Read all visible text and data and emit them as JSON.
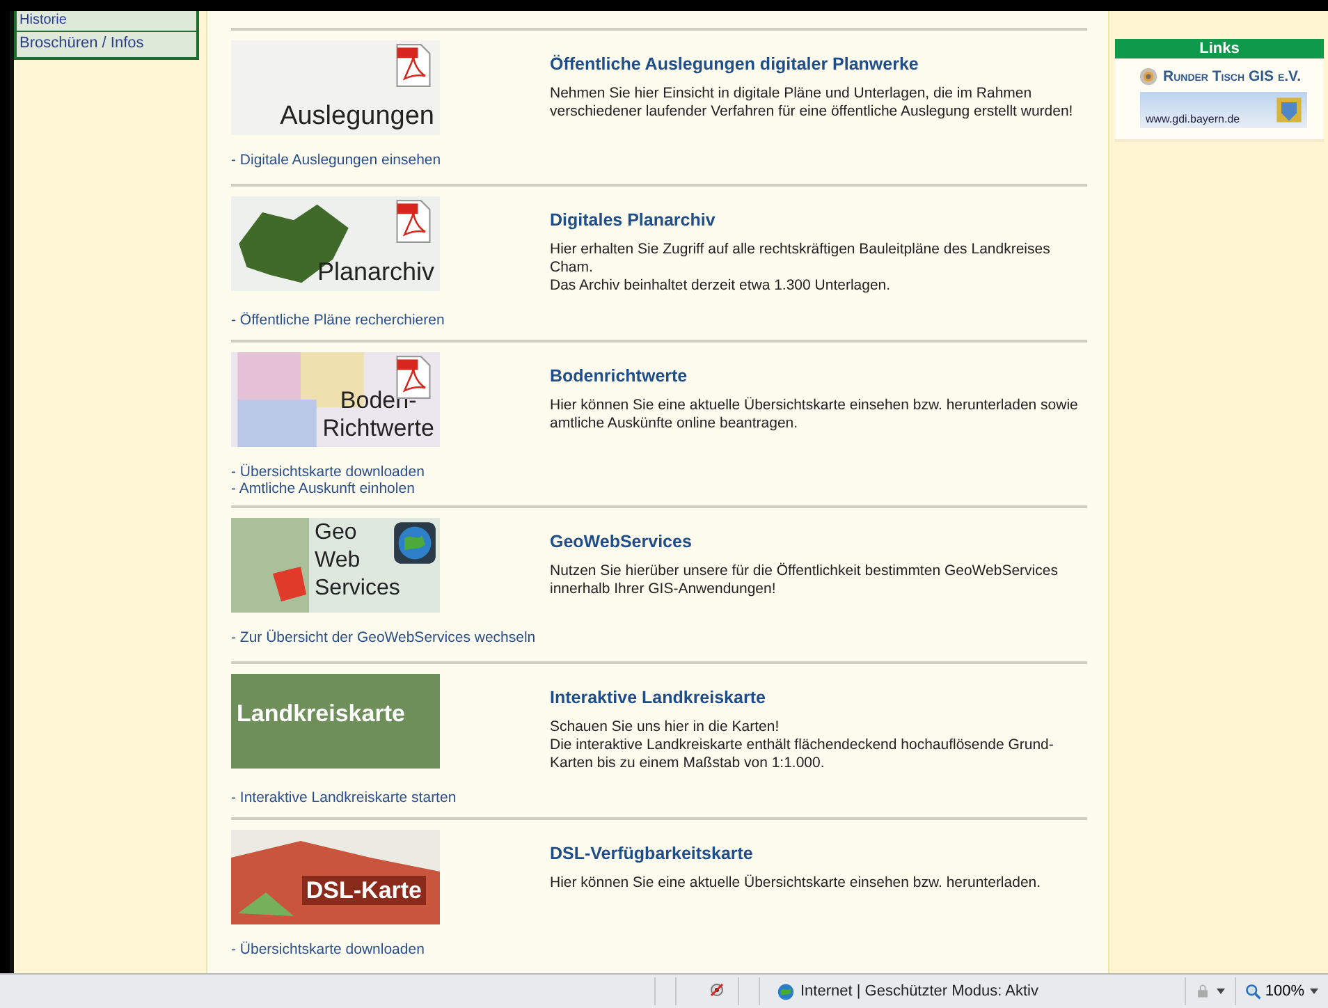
{
  "sidebar": {
    "items": [
      {
        "label": "Historie",
        "selected": false
      },
      {
        "label": "Broschüren / Infos",
        "selected": false
      }
    ]
  },
  "sections": [
    {
      "thumbnail": {
        "caption": [
          "Auslegungen"
        ],
        "pdf_icon": true,
        "globe_icon": false,
        "kind": "plans"
      },
      "title": "Öffentliche Auslegungen digitaler Planwerke",
      "lines": [
        "Nehmen Sie hier Einsicht in digitale Pläne und Unterlagen, die im Rahmen verschiedener laufender Verfahren für eine öffentliche Auslegung erstellt wurden!"
      ],
      "links": [
        "- Digitale Auslegungen einsehen"
      ]
    },
    {
      "thumbnail": {
        "caption": [
          "Planarchiv"
        ],
        "pdf_icon": true,
        "globe_icon": false,
        "kind": "district"
      },
      "title": "Digitales Planarchiv",
      "lines": [
        "Hier erhalten Sie Zugriff auf alle rechtskräftigen Bauleitpläne des Landkreises Cham.",
        "Das Archiv beinhaltet derzeit etwa 1.300 Unterlagen."
      ],
      "links": [
        "- Öffentliche Pläne recherchieren"
      ]
    },
    {
      "thumbnail": {
        "caption": [
          "Boden-",
          "Richtwerte"
        ],
        "pdf_icon": true,
        "globe_icon": false,
        "kind": "zones"
      },
      "title": "Bodenrichtwerte",
      "lines": [
        "Hier können Sie eine aktuelle Übersichtskarte einsehen bzw. herunterladen sowie amtliche Auskünfte online beantragen."
      ],
      "links": [
        "- Übersichtskarte downloaden",
        "- Amtliche Auskunft einholen"
      ]
    },
    {
      "thumbnail": {
        "caption": [
          "Geo",
          "Web",
          "Services"
        ],
        "pdf_icon": false,
        "globe_icon": true,
        "kind": "screen"
      },
      "title": "GeoWebServices",
      "lines": [
        "Nutzen Sie hierüber unsere für die Öffentlichkeit bestimmten GeoWebServices innerhalb Ihrer GIS-Anwendungen!"
      ],
      "links": [
        "- Zur Übersicht der GeoWebServices wechseln"
      ]
    },
    {
      "thumbnail": {
        "caption": [
          "Landkreiskarte"
        ],
        "pdf_icon": false,
        "globe_icon": false,
        "kind": "banner"
      },
      "title": "Interaktive Landkreiskarte",
      "lines": [
        "Schauen Sie uns hier in die Karten!",
        "Die interaktive Landkreiskarte enthält flächendeckend hochauflösende Grund-Karten bis zu einem Maßstab von 1:1.000."
      ],
      "links": [
        "- Interaktive Landkreiskarte starten"
      ]
    },
    {
      "thumbnail": {
        "caption": [
          "DSL-Karte"
        ],
        "pdf_icon": false,
        "globe_icon": false,
        "kind": "dsl"
      },
      "title": "DSL-Verfügbarkeitskarte",
      "lines": [
        "Hier können Sie eine aktuelle Übersichtskarte einsehen bzw. herunterladen."
      ],
      "links": [
        "- Übersichtskarte downloaden"
      ]
    }
  ],
  "links_box": {
    "title": "Links",
    "items": [
      {
        "kind": "logo",
        "label": "Runder Tisch GIS e.V."
      },
      {
        "kind": "banner",
        "label": "www.gdi.bayern.de"
      }
    ]
  },
  "status_bar": {
    "zone": "Internet | Geschützter Modus: Aktiv",
    "zoom": "100%"
  }
}
